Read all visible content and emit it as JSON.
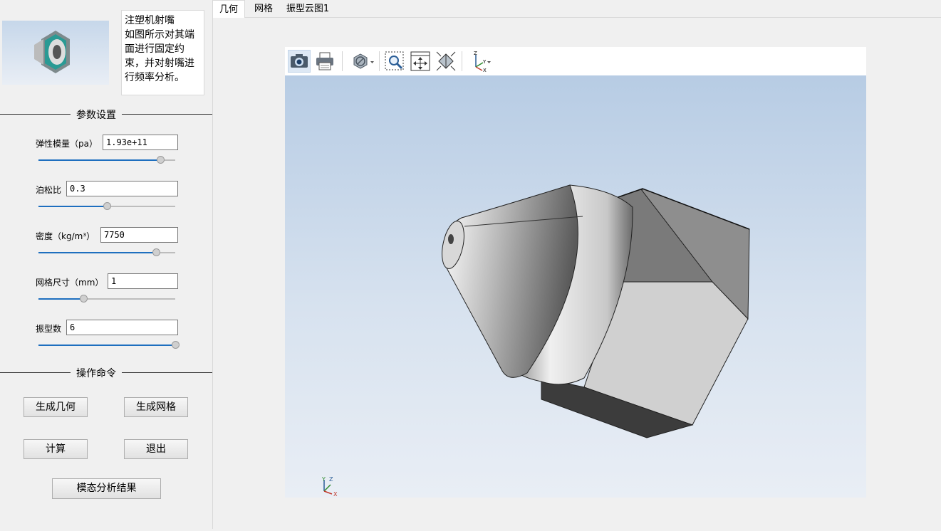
{
  "description": {
    "lines": [
      "注塑机射嘴",
      "如图所示对其端",
      "面进行固定约",
      "束，并对射嘴进",
      "行频率分析。"
    ]
  },
  "params_section": {
    "title": "参数设置"
  },
  "params": [
    {
      "label": "弹性模量（pa）",
      "value": "1.93e+11",
      "slider_fraction": 0.89
    },
    {
      "label": "泊松比",
      "value": "0.3",
      "slider_fraction": 0.5
    },
    {
      "label": "密度（kg/m³）",
      "value": "7750",
      "slider_fraction": 0.86
    },
    {
      "label": "网格尺寸（mm）",
      "value": "1",
      "slider_fraction": 0.33
    },
    {
      "label": "振型数",
      "value": "6",
      "slider_fraction": 1.0
    }
  ],
  "ops_section": {
    "title": "操作命令"
  },
  "buttons": {
    "gen_geometry": "生成几何",
    "gen_mesh": "生成网格",
    "compute": "计算",
    "exit": "退出",
    "modal_results": "模态分析结果"
  },
  "tabs": [
    {
      "label": "几何",
      "active": true
    },
    {
      "label": "网格",
      "active": false
    },
    {
      "label": "振型云图1",
      "active": false
    }
  ],
  "viewer": {
    "toolbar": [
      "camera-icon",
      "print-icon",
      "display-mode-icon",
      "zoom-window-icon",
      "fit-all-icon",
      "view-iso-icon",
      "axes-icon"
    ],
    "axis_labels": {
      "x": "X",
      "y": "Y",
      "z": "Z"
    },
    "colors": {
      "accent": "#1e6fbf",
      "bg_top": "#b7cce4",
      "bg_bottom": "#e9eef5"
    }
  }
}
